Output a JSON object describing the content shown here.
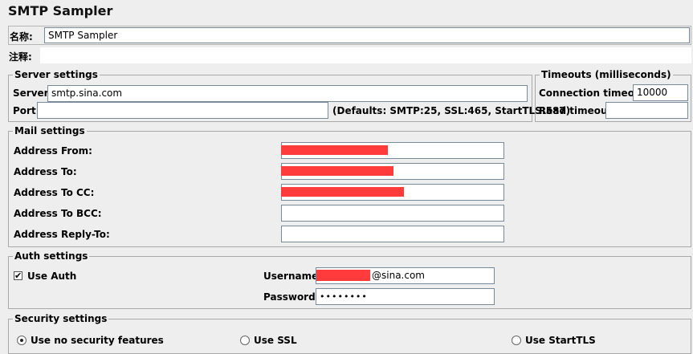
{
  "title": "SMTP Sampler",
  "name_label": "名称:",
  "name_value": "SMTP Sampler",
  "comment_label": "注释:",
  "comment_value": "",
  "server": {
    "title": "Server settings",
    "server_label": "Server:",
    "server_value": "smtp.sina.com",
    "port_label": "Port:",
    "port_value": "",
    "defaults_note": "(Defaults: SMTP:25, SSL:465, StartTLS:587)"
  },
  "timeouts": {
    "title": "Timeouts (milliseconds)",
    "conn_label": "Connection timeout:",
    "conn_value": "10000",
    "read_label": "Read timeout:",
    "read_value": ""
  },
  "mail": {
    "title": "Mail settings",
    "from_label": "Address From:",
    "to_label": "Address To:",
    "cc_label": "Address To CC:",
    "bcc_label": "Address To BCC:",
    "replyto_label": "Address Reply-To:",
    "bcc_value": "",
    "replyto_value": ""
  },
  "auth": {
    "title": "Auth settings",
    "use_auth_label": "Use Auth",
    "use_auth_checked": true,
    "username_label": "Username:",
    "username_suffix": "@sina.com",
    "password_label": "Password:",
    "password_value": "••••••••"
  },
  "security": {
    "title": "Security settings",
    "options": [
      {
        "label": "Use no security features",
        "selected": true
      },
      {
        "label": "Use SSL",
        "selected": false
      },
      {
        "label": "Use StartTLS",
        "selected": false
      }
    ]
  },
  "colors": {
    "redaction": "#ff3b3b",
    "background": "#eeeeee"
  }
}
